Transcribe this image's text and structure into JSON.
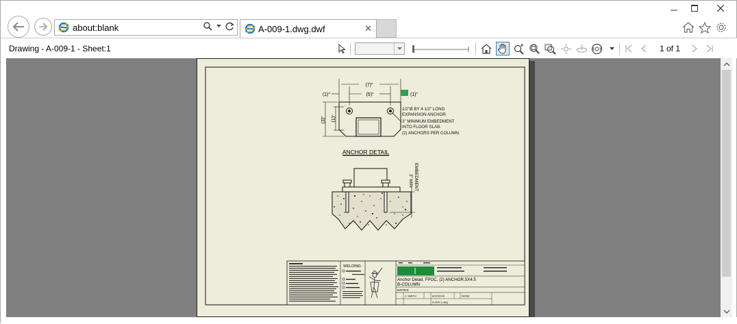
{
  "browser": {
    "address": "about:blank",
    "tab_title": "A-009-1.dwg.dwf",
    "tab_close": "✕",
    "window_controls": {
      "minimize": "minimize-icon",
      "maximize": "maximize-icon",
      "close": "close-icon"
    },
    "right_icons": [
      "home-icon",
      "star-icon",
      "gear-icon"
    ]
  },
  "toolbar": {
    "sheet_label": "Drawing - A-009-1 - Sheet:1",
    "zoom_value": "",
    "page_info": "1 of 1",
    "tools": [
      "select-icon",
      "home-view-icon",
      "pan-icon",
      "zoom-icon",
      "zoom-rect-icon",
      "fit-icon",
      "orbit-icon",
      "turntable-icon",
      "steering-icon"
    ]
  },
  "drawing": {
    "dim_total": "(7)\"",
    "dim_mid": "(5)\"",
    "dim_left": "(1)\"",
    "dim_right": "(1)\"",
    "dim_v_outer": "(3)\"",
    "dim_v_inner": "(1)\"",
    "note_lines": [
      "1/2\"Ø BY 4 1/2\" LONG",
      "EXPANSION ANCHOR.",
      "3\" MINIMUM EMBEDMENT",
      "INTO FLOOR SLAB.",
      "(2) ANCHORS PER COLUMN."
    ],
    "detail_title": "ANCHOR DETAIL",
    "embed_label_1": "3\" MIN",
    "embed_label_2": "EMBEDMENT",
    "title_block": {
      "welding": "WELDING",
      "desc_line1": "Anchor Detail, FPOC, (2) ANCHOR,5X4.5",
      "desc_line2": "B-COLUMN",
      "notes": "NOTES",
      "drawn_by": "J. SMITH",
      "date": "8/22/2016",
      "scale": "NONE",
      "file": "A-009-1.dwg"
    }
  }
}
